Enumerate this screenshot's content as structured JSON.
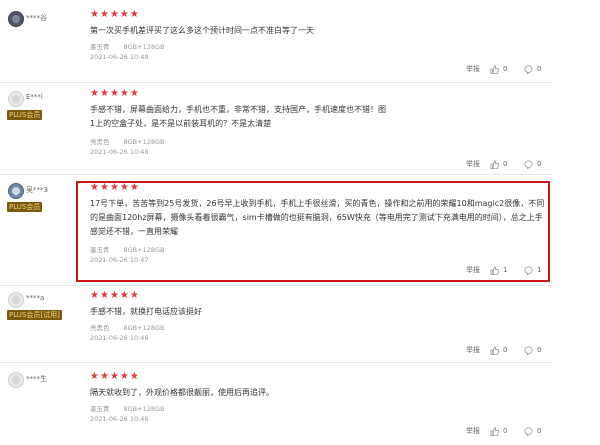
{
  "reviews": [
    {
      "username": "****谷",
      "badge": "",
      "rating": 5,
      "text": "第一次买手机差评买了这么多这个预计时间一点不准白等了一天",
      "sku": {
        "color": "墨玉青",
        "spec": "8GB+128GB"
      },
      "date": "2021-06-26 10:48",
      "report_label": "举报",
      "likes": "0",
      "comments": "0"
    },
    {
      "username": "E***l",
      "badge": "PLUS会员",
      "rating": 5,
      "text": "手感不错，屏幕曲面给力，手机也不重，非常不错，支持国产，手机速度也不错！图1上的空盒子处，是不是以前装耳机的？不是太清楚",
      "sku": {
        "color": "亮黑色",
        "spec": "8GB+128GB"
      },
      "date": "2021-06-26 10:48",
      "report_label": "举报",
      "likes": "0",
      "comments": "0"
    },
    {
      "username": "吴***3",
      "badge": "PLUS会员",
      "rating": 5,
      "text": "17号下单，苦苦等到25号发货，26号早上收到手机，手机上手很丝滑，买的青色，操作和之前用的荣耀10和magic2很像，不同的是曲面120hz屏幕，摄像头看着很霸气，sim卡槽做的也挺有脑洞，65W快充（等电用完了测试下充满电用的时间），总之上手感觉还不错，一直用荣耀",
      "sku": {
        "color": "墨玉青",
        "spec": "8GB+128GB"
      },
      "date": "2021-06-26 10:47",
      "report_label": "举报",
      "likes": "1",
      "comments": "1"
    },
    {
      "username": "****a",
      "badge": "PLUS会员[试用]",
      "rating": 5,
      "text": "手感不错，就换打电话应该挺好",
      "sku": {
        "color": "亮黑色",
        "spec": "8GB+128GB"
      },
      "date": "2021-06-26 10:46",
      "report_label": "举报",
      "likes": "0",
      "comments": "0"
    },
    {
      "username": "****生",
      "badge": "",
      "rating": 5,
      "text": "隔天就收到了，外观价格都很靓丽，使用后再追评。",
      "sku": {
        "color": "墨玉青",
        "spec": "8GB+128GB"
      },
      "date": "2021-06-26 10:46",
      "report_label": "举报",
      "likes": "0",
      "comments": "0"
    }
  ],
  "colors": {
    "star": "#e4393c",
    "badge_bg": "#7a5a0b",
    "badge_text": "#f3d58c",
    "highlight_border": "#c9181e"
  },
  "icons": {
    "like": "thumbs-up-icon",
    "comment": "comment-icon",
    "star": "star-icon"
  }
}
